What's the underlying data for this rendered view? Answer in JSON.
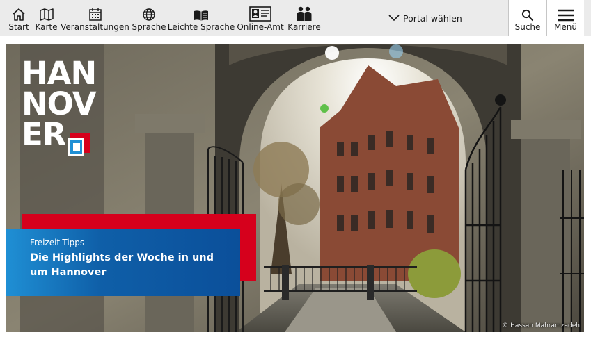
{
  "nav": {
    "items": [
      {
        "label": "Start",
        "icon": "home-icon"
      },
      {
        "label": "Karte",
        "icon": "map-icon"
      },
      {
        "label": "Veranstaltungen",
        "icon": "calendar-icon"
      },
      {
        "label": "Sprache",
        "icon": "globe-icon"
      },
      {
        "label": "Leichte Sprache",
        "icon": "book-icon"
      },
      {
        "label": "Online-Amt",
        "icon": "id-card-icon"
      },
      {
        "label": "Karriere",
        "icon": "people-icon"
      }
    ],
    "portal_label": "Portal wählen",
    "search_label": "Suche",
    "menu_label": "Menü"
  },
  "hero": {
    "logo_lines": [
      "HAN",
      "NOV",
      "ER"
    ],
    "teaser": {
      "kicker": "Freizeit-Tipps",
      "headline": "Die Highlights der Woche in und um Hannover"
    },
    "credit": "© Hassan Mahramzadeh"
  },
  "colors": {
    "nav_bg": "#ebebeb",
    "brand_red": "#d6001c",
    "brand_blue": "#0b4f9a",
    "brand_light_blue": "#1f8fd4"
  }
}
